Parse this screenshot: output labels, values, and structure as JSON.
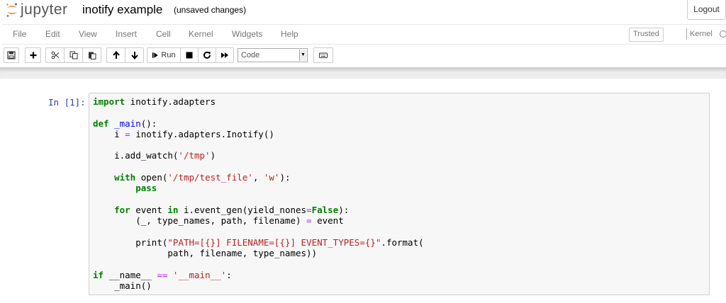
{
  "header": {
    "logo_text": "jupyter",
    "notebook_name": "inotify example",
    "save_status": "(unsaved changes)",
    "logout_label": "Logout"
  },
  "menubar": {
    "items": [
      "File",
      "Edit",
      "View",
      "Insert",
      "Cell",
      "Kernel",
      "Widgets",
      "Help"
    ],
    "trusted_label": "Trusted",
    "kernel_label": "Kernel"
  },
  "toolbar": {
    "run_label": "Run",
    "cell_type_value": "Code",
    "icons": [
      "save-icon",
      "plus-icon",
      "cut-icon",
      "copy-icon",
      "paste-icon",
      "arrow-up-icon",
      "arrow-down-icon",
      "run-icon",
      "stop-icon",
      "restart-icon",
      "fast-forward-icon",
      "keyboard-icon"
    ]
  },
  "cell": {
    "prompt": "In [1]:",
    "lines": [
      [
        [
          "kw",
          "import"
        ],
        [
          "",
          ""
        ],
        [
          "",
          " inotify.adapters"
        ]
      ],
      [],
      [
        [
          "kw",
          "def"
        ],
        [
          "",
          " "
        ],
        [
          "fn",
          "_main"
        ],
        [
          "",
          "():"
        ]
      ],
      [
        [
          "",
          "    i "
        ],
        [
          "op",
          "="
        ],
        [
          "",
          " inotify.adapters.Inotify()"
        ]
      ],
      [],
      [
        [
          "",
          "    i.add_watch("
        ],
        [
          "st",
          "'/tmp'"
        ],
        [
          "",
          ")"
        ]
      ],
      [],
      [
        [
          "",
          "    "
        ],
        [
          "kw",
          "with"
        ],
        [
          "",
          ""
        ],
        [
          "",
          " "
        ],
        [
          "",
          "open"
        ],
        [
          "",
          "("
        ],
        [
          "st",
          "'/tmp/test_file'"
        ],
        [
          "",
          ", "
        ],
        [
          "st",
          "'w'"
        ],
        [
          "",
          "):"
        ]
      ],
      [
        [
          "",
          "        "
        ],
        [
          "kw",
          "pass"
        ]
      ],
      [],
      [
        [
          "",
          "    "
        ],
        [
          "kw",
          "for"
        ],
        [
          "",
          " event "
        ],
        [
          "kw",
          "in"
        ],
        [
          "",
          " i.event_gen(yield_nones"
        ],
        [
          "op",
          "="
        ],
        [
          "kw",
          "False"
        ],
        [
          "",
          "):"
        ]
      ],
      [
        [
          "",
          "        (_, type_names, path, filename) "
        ],
        [
          "op",
          "="
        ],
        [
          "",
          " event"
        ]
      ],
      [],
      [
        [
          "",
          "        "
        ],
        [
          "",
          "print"
        ],
        [
          "",
          "("
        ],
        [
          "st",
          "\"PATH=[{}] FILENAME=[{}] EVENT_TYPES={}\""
        ],
        [
          "",
          ".format("
        ]
      ],
      [
        [
          "",
          "              path, filename, type_names))"
        ]
      ],
      [],
      [
        [
          "kw",
          "if"
        ],
        [
          "",
          " __name__ "
        ],
        [
          "op",
          "=="
        ],
        [
          "",
          " "
        ],
        [
          "st",
          "'__main__'"
        ],
        [
          "",
          ":"
        ]
      ],
      [
        [
          "",
          "    _main()"
        ]
      ]
    ]
  },
  "colors": {
    "prompt_in": "#303f9f",
    "keyword": "#008000",
    "string": "#ba2121",
    "operator": "#aa22ff",
    "function_def": "#0000ff",
    "logo_orange": "#f37726"
  }
}
